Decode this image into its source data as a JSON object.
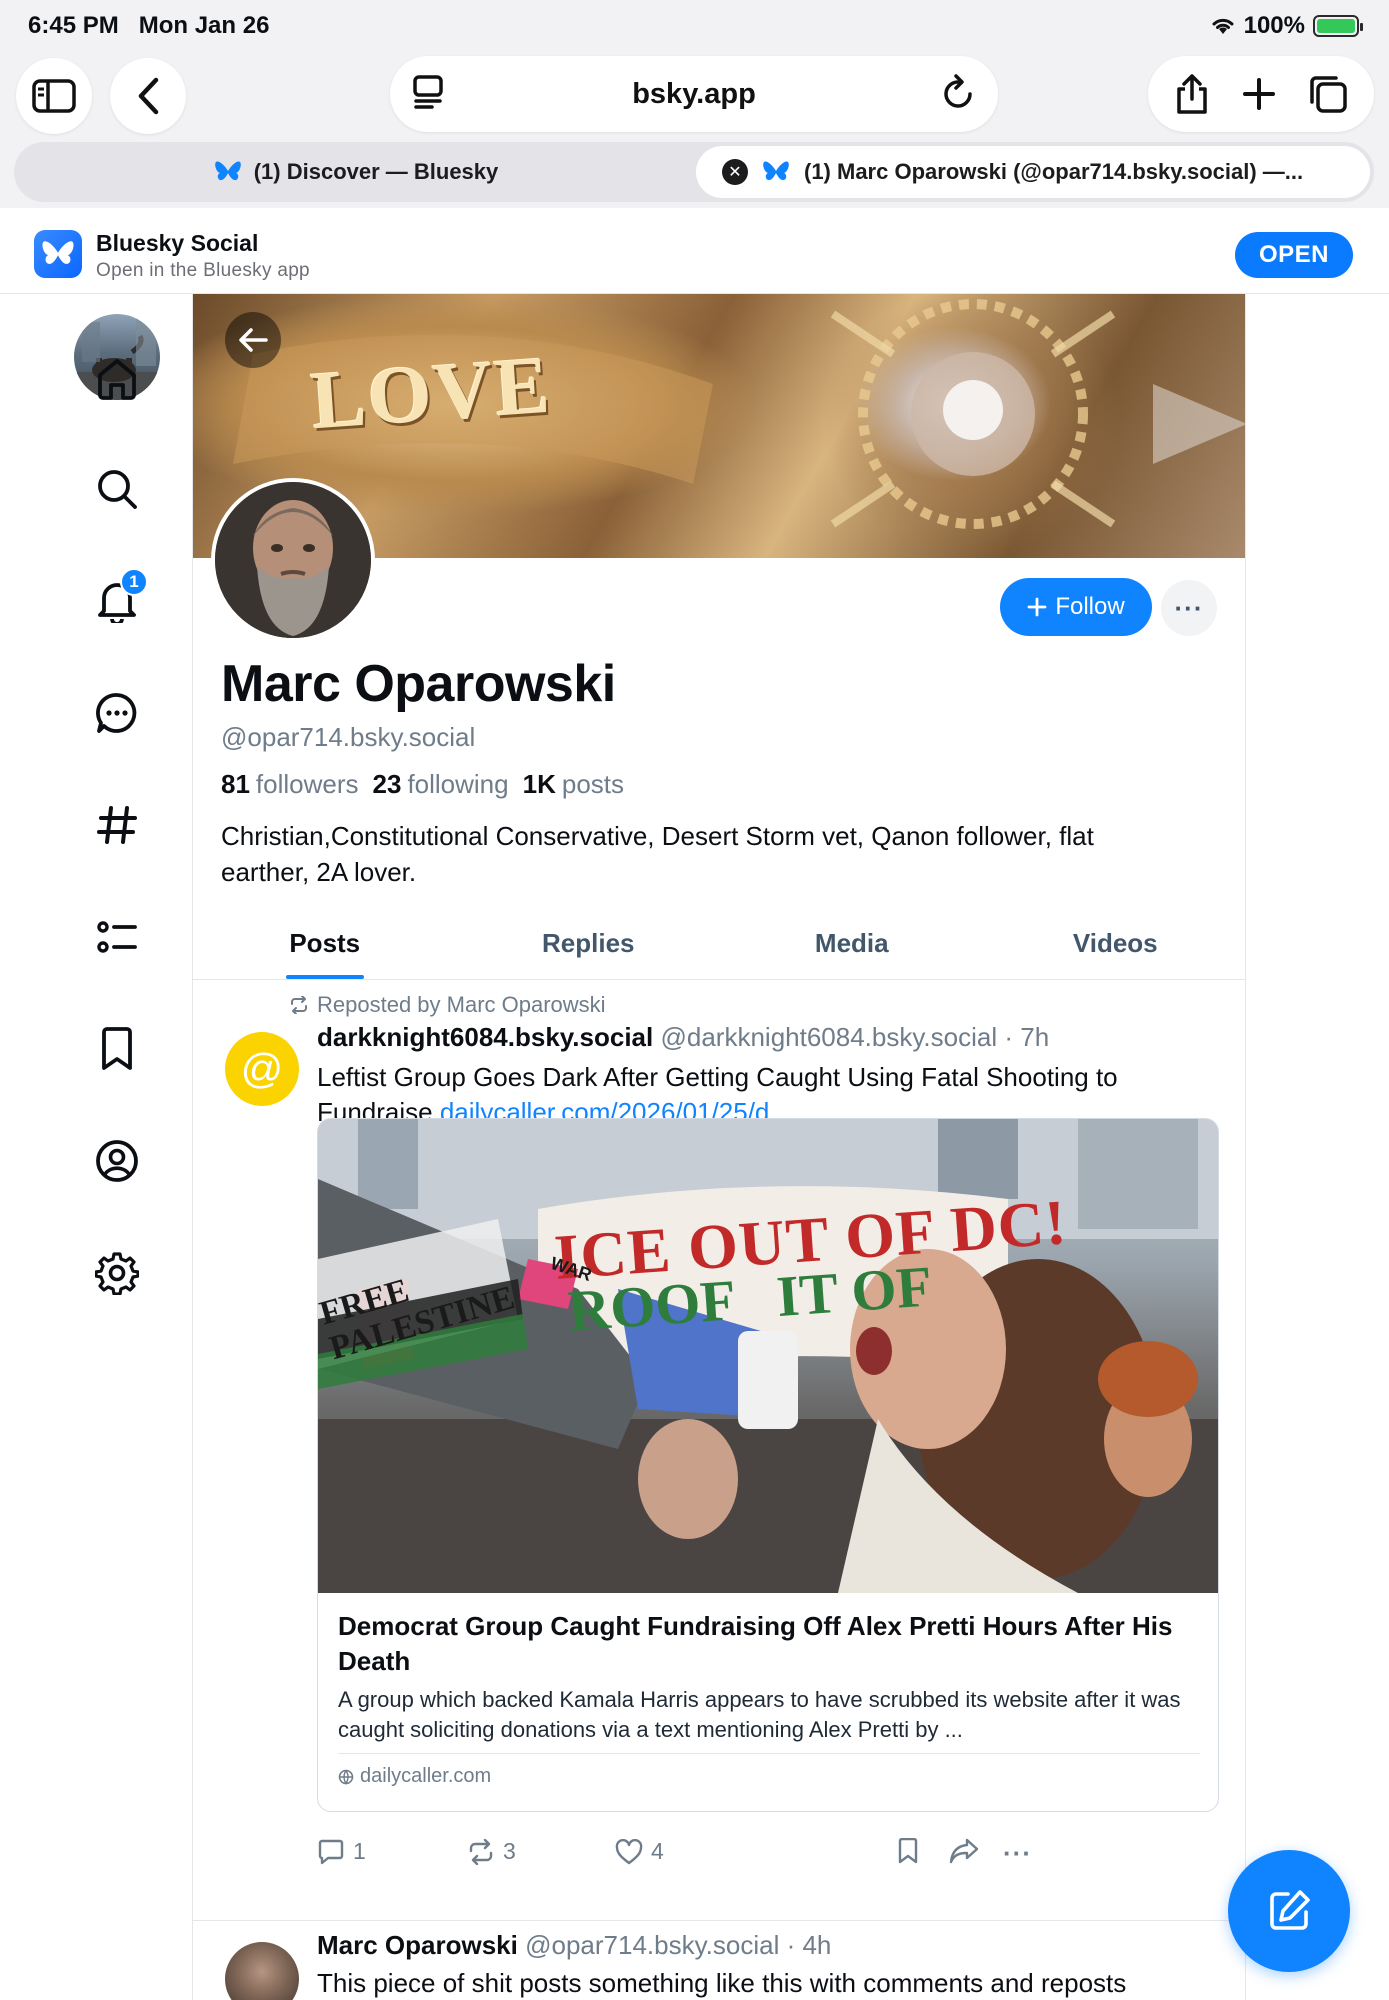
{
  "status_bar": {
    "time": "6:45 PM",
    "date": "Mon Jan 26",
    "battery": "100%",
    "battery_level": 1.0
  },
  "browser": {
    "url": "bsky.app",
    "tabs": [
      {
        "label": "(1) Discover — Bluesky"
      },
      {
        "label": "(1) Marc Oparowski (@opar714.bsky.social) —..."
      }
    ]
  },
  "app_banner": {
    "name": "Bluesky Social",
    "subtitle": "Open in the Bluesky app",
    "open_label": "OPEN"
  },
  "nav": {
    "notification_badge": "1"
  },
  "profile": {
    "banner_text": "LOVE",
    "follow_label": "Follow",
    "more_label": "···",
    "display_name": "Marc Oparowski",
    "handle": "@opar714.bsky.social",
    "followers_count": "81",
    "followers_label": "followers",
    "following_count": "23",
    "following_label": "following",
    "posts_count": "1K",
    "posts_label": "posts",
    "bio": "Christian,Constitutional Conservative, Desert Storm vet, Qanon follower, flat earther, 2A lover.",
    "tabs": [
      "Posts",
      "Replies",
      "Media",
      "Videos"
    ]
  },
  "post": {
    "repost_label": "Reposted by Marc Oparowski",
    "avatar_glyph": "@",
    "author_name": "darkknight6084.bsky.social",
    "author_meta": "@darkknight6084.bsky.social · 7h",
    "text": "Leftist Group Goes Dark After Getting Caught Using Fatal Shooting to Fundraise ",
    "link": "dailycaller.com/2026/01/25/d...",
    "card": {
      "image_sign_line1": "ICE OUT OF DC!",
      "image_sign_line2": "ROOF   IT OF",
      "image_banner": "FREE PALESTINE",
      "megaphone_sticker": "WAR",
      "title": "Democrat Group Caught Fundraising Off Alex Pretti Hours After His Death",
      "description": "A group which backed Kamala Harris appears to have scrubbed its website after it was caught soliciting donations via a text mentioning Alex Pretti by ...",
      "domain": "dailycaller.com"
    },
    "reply_count": "1",
    "repost_count": "3",
    "like_count": "4"
  },
  "post2": {
    "author_name": "Marc Oparowski",
    "author_meta": "@opar714.bsky.social · 4h",
    "text": "This piece of shit posts something like this with comments and reposts"
  }
}
